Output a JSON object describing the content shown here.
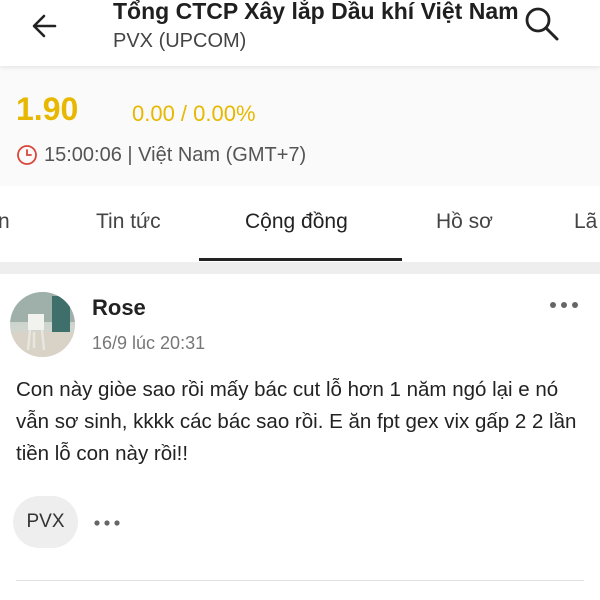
{
  "header": {
    "title": "Tổng CTCP Xây lắp Dầu khí Việt Nam",
    "subtitle": "PVX (UPCOM)",
    "back_icon": "arrow-left-icon",
    "search_icon": "search-icon"
  },
  "quote": {
    "price": "1.90",
    "change": "0.00 / 0.00%",
    "time": "15:00:06 | Việt Nam (GMT+7)",
    "accent_color": "#e8b700"
  },
  "tabs": [
    {
      "label": "n"
    },
    {
      "label": "Tin tức"
    },
    {
      "label": "Cộng đồng",
      "active": true
    },
    {
      "label": "Hồ sơ"
    },
    {
      "label": "Lã"
    }
  ],
  "post": {
    "author": "Rose",
    "timestamp": "16/9 lúc 20:31",
    "content": "Con này giòe sao rồi mấy bác cut lỗ hơn 1 năm ngó lại e nó vẫn sơ sinh, kkkk các bác sao rồi. E ăn fpt gex vix gấp 2 2 lần tiền lỗ con này rồi!!",
    "tag": "PVX"
  }
}
